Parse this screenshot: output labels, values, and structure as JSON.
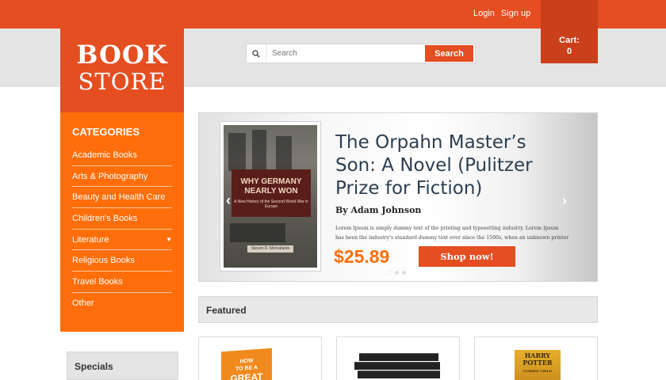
{
  "top_links": {
    "login": "Login",
    "signup": "Sign up"
  },
  "cart": {
    "label": "Cart:",
    "count": "0"
  },
  "logo": {
    "line1": "BOOK",
    "line2": "STORE"
  },
  "search": {
    "placeholder": "Search",
    "button": "Search"
  },
  "categories": {
    "title": "CATEGORIES",
    "items": [
      {
        "label": "Academic Books"
      },
      {
        "label": "Arts & Photography"
      },
      {
        "label": "Beauty and Health Care"
      },
      {
        "label": "Children's Books"
      },
      {
        "label": "Literature"
      },
      {
        "label": "Religious Books"
      },
      {
        "label": "Travel Books"
      },
      {
        "label": "Other"
      }
    ]
  },
  "specials": {
    "title": "Specials"
  },
  "slider": {
    "book_title": "The Orpahn Master’s Son: A Novel (Pulitzer Prize for Fiction)",
    "author": "By Adam Johnson",
    "desc_line1": "Lorem Ipsum is simply dummy text of the printing and typesetting industry. Lorem Ipsum",
    "desc_line2": "has been the industry's standard dummy text ever since the 1500s, when an unknown printer",
    "price": "$25.89",
    "cta": "Shop now!",
    "cover": {
      "title_line1": "WHY GERMANY",
      "title_line2": "NEARLY WON",
      "subtitle": "A New History of the Second World War in Europe",
      "author": "Steven D. Mercatante"
    }
  },
  "featured": {
    "title": "Featured"
  },
  "featured_books": {
    "how": {
      "line1": "HOW",
      "line2": "TO BE A",
      "line3": "GREAT"
    },
    "hp": {
      "title1": "HARRY",
      "title2": "POTTER",
      "subtitle": "CURSED CHILD"
    }
  },
  "colors": {
    "brand": "#e44e21",
    "sidebar": "#ff6e0a",
    "header_bg": "#e4e4e4"
  }
}
